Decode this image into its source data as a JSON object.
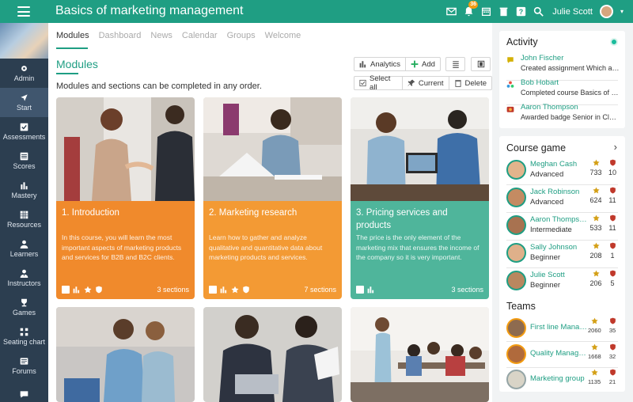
{
  "app": {
    "title": "Basics of marketing management"
  },
  "topbar": {
    "notification_count": "36",
    "user_name": "Julie Scott"
  },
  "sidebar": {
    "items": [
      {
        "label": "Admin",
        "icon": "gear-icon"
      },
      {
        "label": "Start",
        "icon": "navigation-arrow-icon",
        "active": true
      },
      {
        "label": "Assessments",
        "icon": "checkbox-icon"
      },
      {
        "label": "Scores",
        "icon": "scores-icon"
      },
      {
        "label": "Mastery",
        "icon": "bar-chart-icon"
      },
      {
        "label": "Resources",
        "icon": "grid-icon"
      },
      {
        "label": "Learners",
        "icon": "person-icon"
      },
      {
        "label": "Instructors",
        "icon": "instructor-icon"
      },
      {
        "label": "Games",
        "icon": "trophy-icon"
      },
      {
        "label": "Seating chart",
        "icon": "seating-icon"
      },
      {
        "label": "Forums",
        "icon": "forum-icon"
      },
      {
        "label": "",
        "icon": "chat-icon"
      }
    ]
  },
  "main": {
    "tabs": [
      "Modules",
      "Dashboard",
      "News",
      "Calendar",
      "Groups",
      "Welcome"
    ],
    "section_title": "Modules",
    "subtitle": "Modules and sections can be completed in any order.",
    "buttons": {
      "analytics": "Analytics",
      "add": "Add",
      "select_all": "Select all",
      "current": "Current",
      "delete": "Delete"
    },
    "cards": [
      {
        "title": "1. Introduction",
        "description": "In this course, you will learn the most important aspects of marketing products and services for B2B and B2C clients.",
        "sections": "3 sections",
        "color": "#f08a2c"
      },
      {
        "title": "2. Marketing research",
        "description": "Learn how to gather and analyze qualitative and quantitative data about marketing products and services.",
        "sections": "7 sections",
        "color": "#f39a34"
      },
      {
        "title": "3. Pricing services and products",
        "description": "The price is the only element of the marketing mix that ensures the income of the company so it is very important.",
        "sections": "3 sections",
        "color": "#4fb59b"
      }
    ]
  },
  "activity": {
    "title": "Activity",
    "items": [
      {
        "name": "John Fischer",
        "text": "Created assignment Which a…",
        "icon": "assignment-icon"
      },
      {
        "name": "Bob Hobart",
        "text": "Completed course Basics of …",
        "icon": "course-completed-icon"
      },
      {
        "name": "Aaron Thompson",
        "text": "Awarded badge Senior in Cla…",
        "icon": "badge-icon"
      }
    ]
  },
  "course_game": {
    "title": "Course game",
    "players": [
      {
        "name": "Meghan Cash",
        "level": "Advanced",
        "points": "733",
        "badges": "10"
      },
      {
        "name": "Jack Robinson",
        "level": "Advanced",
        "points": "624",
        "badges": "11"
      },
      {
        "name": "Aaron Thompson",
        "level": "Intermediate",
        "points": "533",
        "badges": "11"
      },
      {
        "name": "Sally Johnson",
        "level": "Beginner",
        "points": "208",
        "badges": "1"
      },
      {
        "name": "Julie Scott",
        "level": "Beginner",
        "points": "206",
        "badges": "5"
      }
    ]
  },
  "teams": {
    "title": "Teams",
    "items": [
      {
        "name": "First line Manag…",
        "points": "2060",
        "badges": "35"
      },
      {
        "name": "Quality Manage…",
        "points": "1668",
        "badges": "32"
      },
      {
        "name": "Marketing group",
        "points": "1135",
        "badges": "21"
      }
    ]
  },
  "colors": {
    "brand": "#1f9e83",
    "sidebar": "#2c3e50",
    "orange": "#f08a2c",
    "teal_card": "#4fb59b"
  }
}
